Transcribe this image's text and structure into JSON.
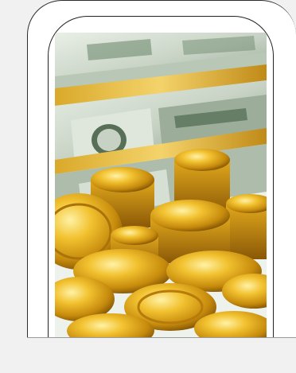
{
  "image": {
    "description_icon": "money-and-gold-coins-image"
  }
}
